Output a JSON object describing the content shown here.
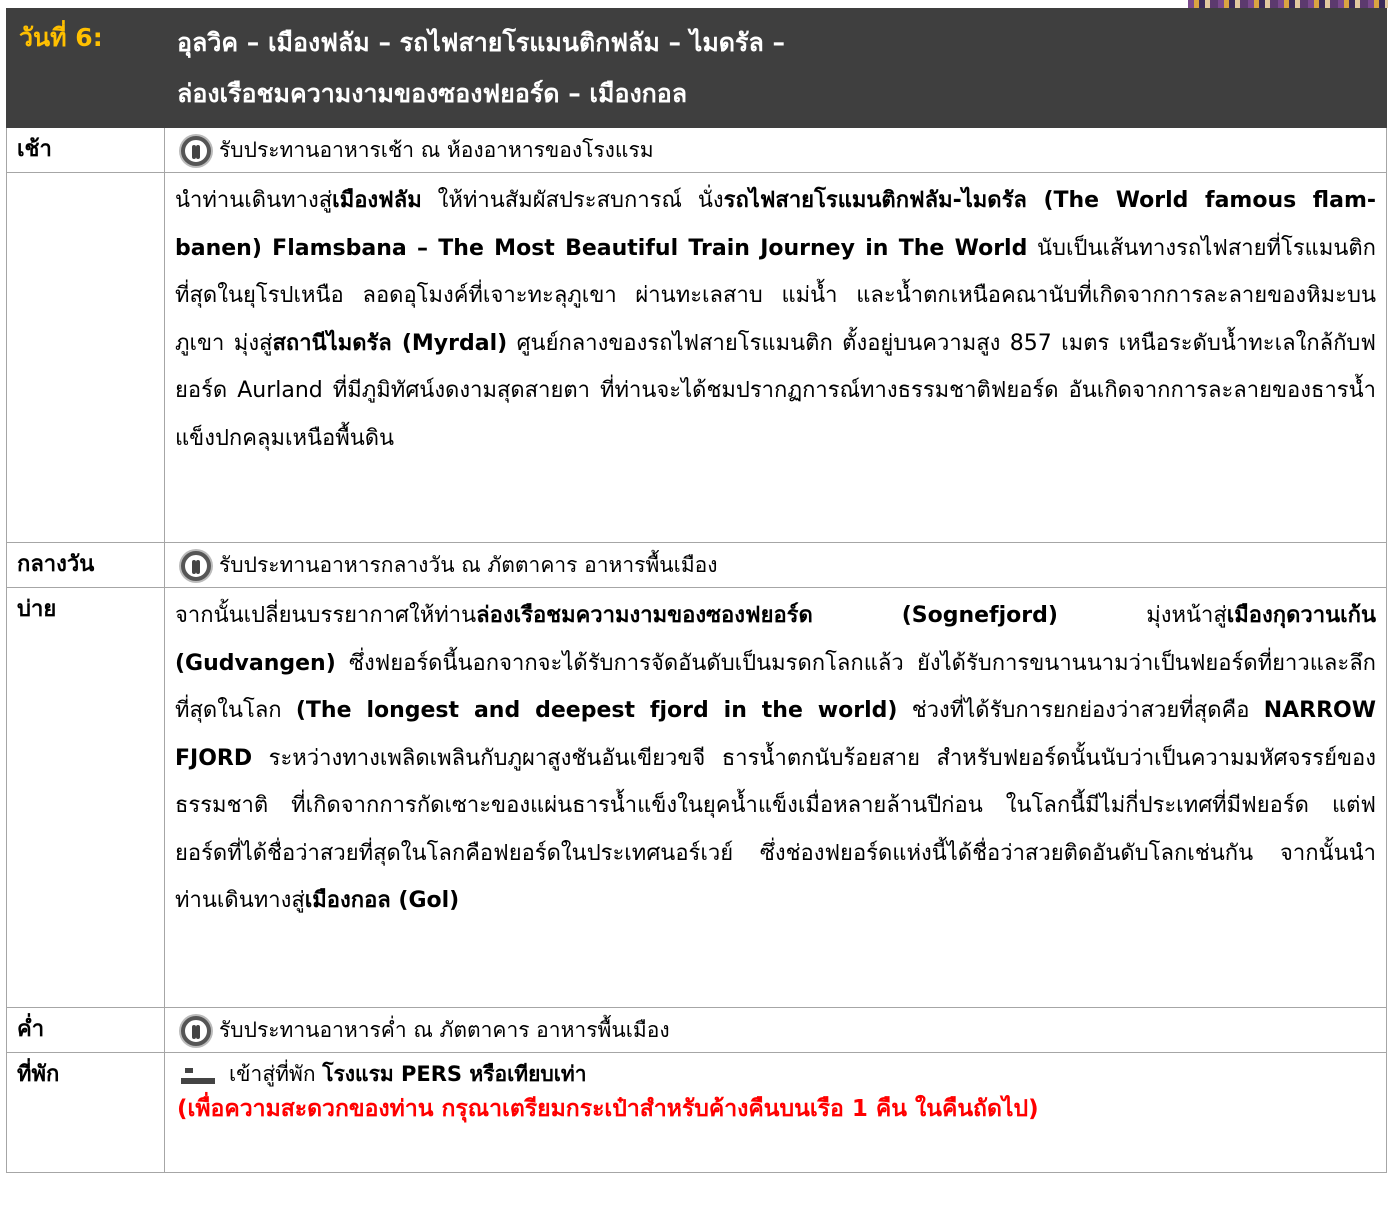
{
  "header": {
    "day_label": "วันที่ 6:",
    "title_line1": "อุลวิค – เมืองฟลัม – รถไฟสายโรแมนติกฟลัม – ไมดรัล –",
    "title_line2": "ล่องเรือชมความงามของซองฟยอร์ด – เมืองกอล"
  },
  "morning": {
    "label": "เช้า",
    "meal_text": "รับประทานอาหารเช้า ณ ห้องอาหารของโรงแรม",
    "icon": "meal-icon"
  },
  "morning_activity": {
    "t1": "นำท่านเดินทางสู่",
    "b1": "เมืองฟลัม",
    "t2": " ให้ท่านสัมผัสประสบการณ์ นั่ง",
    "b2": "รถไฟสายโรแมนติกฟลัม-ไมดรัล (The World famous flam-banen) Flamsbana – The Most Beautiful Train  Journey in The World",
    "t3": " นับเป็นเส้นทางรถไฟสายที่โรแมนติกที่สุดในยุโรปเหนือ ลอดอุโมงค์ที่เจาะทะลุภูเขา ผ่านทะเลสาบ แม่น้ำ และน้ำตกเหนือคณานับที่เกิดจากการละลายของหิมะบนภูเขา มุ่งสู่",
    "b3": "สถานีไมดรัล (Myrdal)",
    "t4": " ศูนย์กลางของรถไฟสายโรแมนติก ตั้งอยู่บนความสูง 857 เมตร เหนือระดับน้ำทะเลใกล้กับฟยอร์ด Aurland ที่มีภูมิทัศน์งดงามสุดสายตา ที่ท่านจะได้ชมปรากฏการณ์ทางธรรมชาติฟยอร์ด อันเกิดจากการละลายของธารน้ำแข็งปกคลุมเหนือพื้นดิน"
  },
  "lunch": {
    "label": "กลางวัน",
    "meal_text": "รับประทานอาหารกลางวัน ณ ภัตตาคาร อาหารพื้นเมือง",
    "icon": "meal-icon"
  },
  "afternoon": {
    "label": "บ่าย",
    "t1": "จากนั้นเปลี่ยนบรรยากาศให้ท่าน",
    "b1": "ล่องเรือชมความงามของซองฟยอร์ด (Sognefjord)",
    "t2": " มุ่งหน้าสู่",
    "b2": "เมืองกุดวานเก้น (Gudvangen)",
    "t3": " ซึ่งฟยอร์ดนี้นอกจากจะได้รับการจัดอันดับเป็นมรดกโลกแล้ว ยังได้รับการขนานนามว่าเป็นฟยอร์ดที่ยาวและลึกที่สุดในโลก ",
    "b3": "(The longest and deepest fjord in the world)",
    "t4": " ช่วงที่ได้รับการยกย่องว่าสวยที่สุดคือ ",
    "b4": "NARROW FJORD",
    "t5": " ระหว่างทางเพลิดเพลินกับภูผาสูงชันอันเขียวขจี ธารน้ำตกนับร้อยสาย สำหรับฟยอร์ดนั้นนับว่าเป็นความมหัศจรรย์ของธรรมชาติ ที่เกิดจากการกัดเซาะของแผ่นธารน้ำแข็งในยุคน้ำแข็งเมื่อหลายล้านปีก่อน ในโลกนี้มีไม่กี่ประเทศที่มีฟยอร์ด แต่ฟยอร์ดที่ได้ชื่อว่าสวยที่สุดในโลกคือฟยอร์ดในประเทศนอร์เวย์ ซึ่งช่องฟยอร์ดแห่งนี้ได้ชื่อว่าสวยติดอันดับโลกเช่นกัน  จากนั้นนำท่านเดินทางสู่",
    "b5": "เมืองกอล (Gol)"
  },
  "dinner": {
    "label": "ค่ำ",
    "meal_text": "รับประทานอาหารค่ำ ณ ภัตตาคาร อาหารพื้นเมือง",
    "icon": "meal-icon"
  },
  "stay": {
    "label": "ที่พัก",
    "icon": "bed-icon",
    "text": "เข้าสู่ที่พัก ",
    "hotel": "โรงแรม PERS หรือเทียบเท่า",
    "note": "(เพื่อความสะดวกของท่าน กรุณาเตรียมกระเป๋าสำหรับค้างคืนบนเรือ 1 คืน ในคืนถัดไป)"
  },
  "colors": {
    "header_bg": "#3f3f3f",
    "day_label": "#ffc000",
    "note_red": "#ff0000",
    "border": "#a6a6a6"
  }
}
